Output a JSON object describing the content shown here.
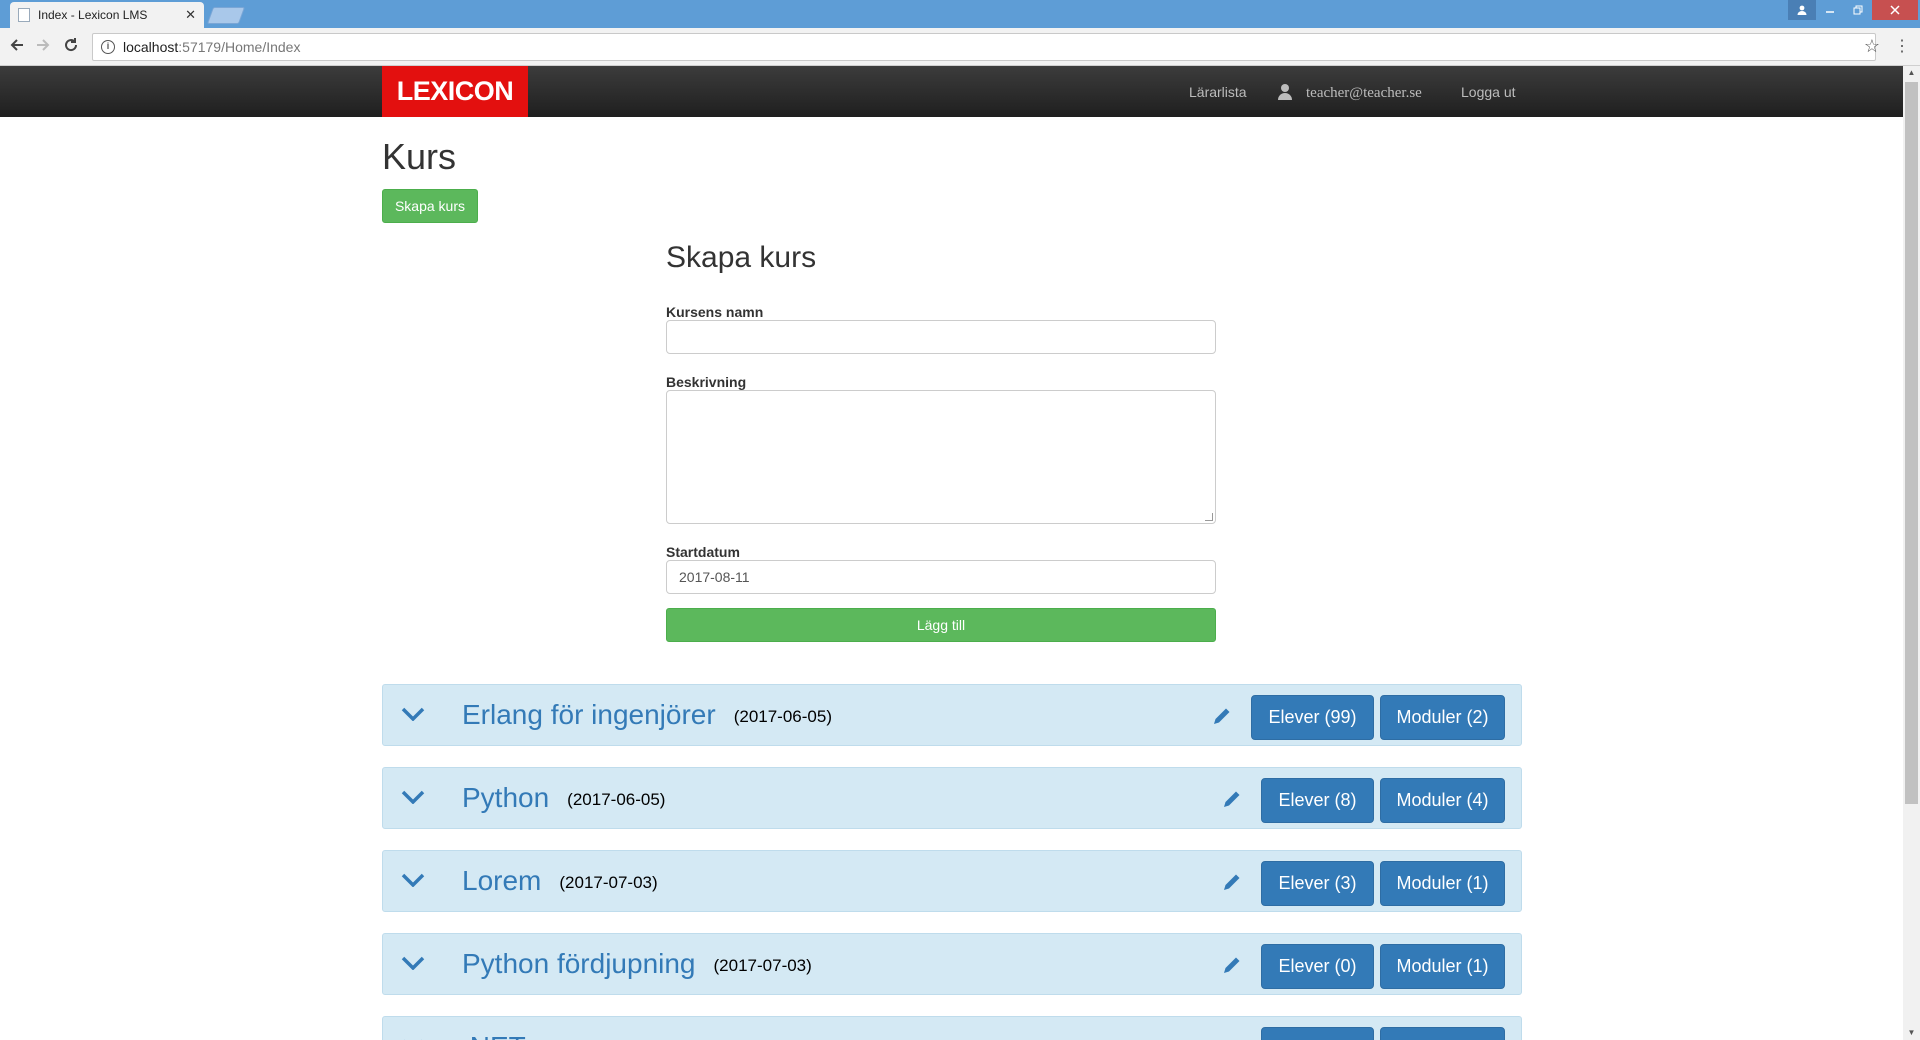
{
  "browser": {
    "tab_title": "Index - Lexicon LMS",
    "tab_close": "✕",
    "url_host": "localhost",
    "url_path": ":57179/Home/Index"
  },
  "navbar": {
    "logo": "LEXICON",
    "teachers_link": "Lärarlista",
    "user_email": "teacher@teacher.se",
    "logout_link": "Logga ut"
  },
  "page": {
    "title": "Kurs",
    "create_button": "Skapa kurs"
  },
  "form": {
    "heading": "Skapa kurs",
    "name_label": "Kursens namn",
    "name_value": "",
    "description_label": "Beskrivning",
    "description_value": "",
    "startdate_label": "Startdatum",
    "startdate_value": "2017-08-11",
    "submit_label": "Lägg till"
  },
  "courses": [
    {
      "name": "Erlang för ingenjörer",
      "date": "(2017-06-05)",
      "students": "Elever (99)",
      "modules": "Moduler (2)"
    },
    {
      "name": "Python",
      "date": "(2017-06-05)",
      "students": "Elever (8)",
      "modules": "Moduler (4)"
    },
    {
      "name": "Lorem",
      "date": "(2017-07-03)",
      "students": "Elever (3)",
      "modules": "Moduler (1)"
    },
    {
      "name": "Python fördjupning",
      "date": "(2017-07-03)",
      "students": "Elever (0)",
      "modules": "Moduler (1)"
    },
    {
      "name": ".NET",
      "date": "",
      "students": "",
      "modules": ""
    }
  ],
  "colors": {
    "accent_blue": "#337ab7",
    "success_green": "#5cb85c",
    "brand_red": "#e3100f",
    "panel_bg": "#d4e9f4"
  }
}
